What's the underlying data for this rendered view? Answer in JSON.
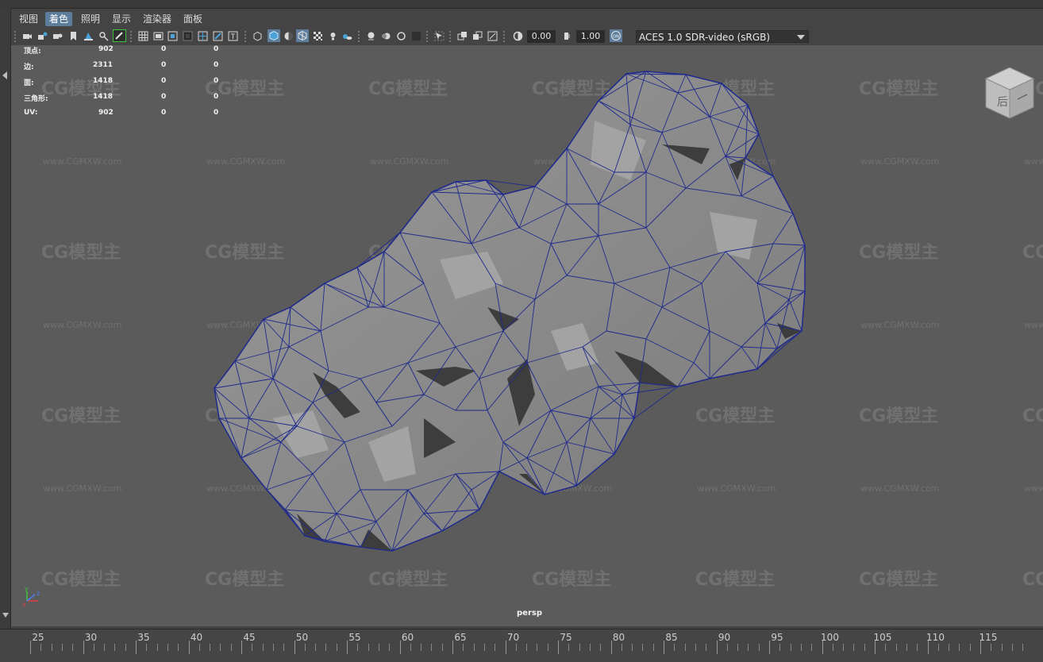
{
  "menu": {
    "items": [
      {
        "label": "视图",
        "active": false
      },
      {
        "label": "着色",
        "active": true
      },
      {
        "label": "照明",
        "active": false
      },
      {
        "label": "显示",
        "active": false
      },
      {
        "label": "渲染器",
        "active": false
      },
      {
        "label": "面板",
        "active": false
      }
    ]
  },
  "toolbar": {
    "exposure_value": "0.00",
    "gamma_value": "1.00",
    "color_transform": "ACES 1.0 SDR-video (sRGB)"
  },
  "hud": {
    "rows": [
      {
        "label": "顶点:",
        "v1": "902",
        "v2": "0",
        "v3": "0"
      },
      {
        "label": "边:",
        "v1": "2311",
        "v2": "0",
        "v3": "0"
      },
      {
        "label": "面:",
        "v1": "1418",
        "v2": "0",
        "v3": "0"
      },
      {
        "label": "三角形:",
        "v1": "1418",
        "v2": "0",
        "v3": "0"
      },
      {
        "label": "UV:",
        "v1": "902",
        "v2": "0",
        "v3": "0"
      }
    ]
  },
  "viewcube_label": "后",
  "camera_name": "persp",
  "watermark": {
    "logo": "CG模型主",
    "url": "www.CGMXW.com"
  },
  "timeline": {
    "labels": [
      "25",
      "30",
      "35",
      "40",
      "45",
      "50",
      "55",
      "60",
      "65",
      "70",
      "75",
      "80",
      "85",
      "90",
      "95",
      "100",
      "105",
      "110",
      "115"
    ]
  },
  "colors": {
    "accent": "#5d7d9c",
    "viewport_bg": "#5b5b5b",
    "mesh_fill": "#8a8a8a",
    "wire": "#1f2a8c"
  }
}
